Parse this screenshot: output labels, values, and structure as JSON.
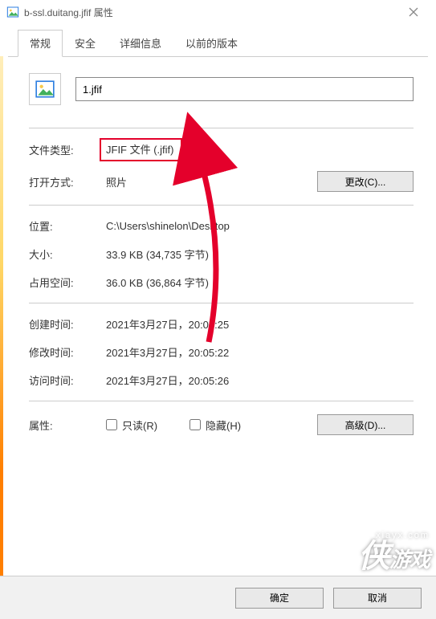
{
  "window": {
    "title": "b-ssl.duitang.jfif 属性"
  },
  "tabs": {
    "general": "常规",
    "security": "安全",
    "details": "详细信息",
    "previous": "以前的版本"
  },
  "file": {
    "name": "1.jfif"
  },
  "labels": {
    "file_type": "文件类型:",
    "opens_with": "打开方式:",
    "location": "位置:",
    "size": "大小:",
    "size_on_disk": "占用空间:",
    "created": "创建时间:",
    "modified": "修改时间:",
    "accessed": "访问时间:",
    "attributes": "属性:"
  },
  "values": {
    "file_type": "JFIF 文件 (.jfif)",
    "opens_with": "照片",
    "location": "C:\\Users\\shinelon\\Desktop",
    "size": "33.9 KB (34,735 字节)",
    "size_on_disk": "36.0 KB (36,864 字节)",
    "created": "2021年3月27日，20:05:25",
    "modified": "2021年3月27日，20:05:22",
    "accessed": "2021年3月27日，20:05:26"
  },
  "buttons": {
    "change": "更改(C)...",
    "advanced": "高级(D)...",
    "ok": "确定",
    "cancel": "取消"
  },
  "checkboxes": {
    "readonly": "只读(R)",
    "hidden": "隐藏(H)"
  },
  "watermark": {
    "brand": "侠",
    "sub": "游戏",
    "url": "xiayx.com"
  },
  "annotation_color": "#e4002b"
}
